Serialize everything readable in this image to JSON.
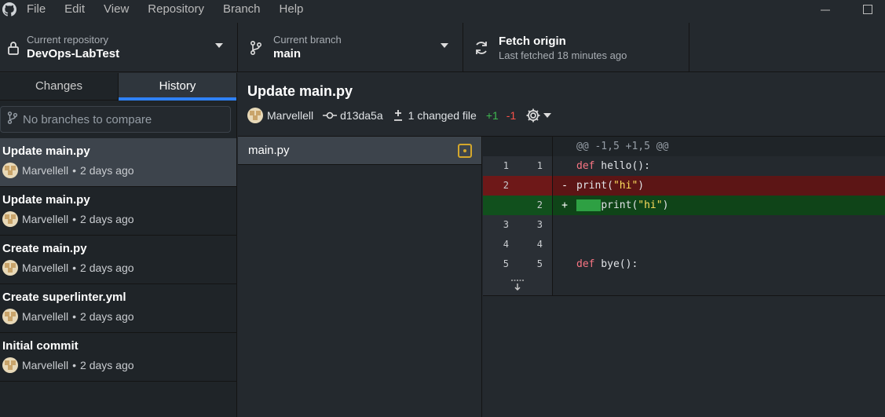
{
  "menu": [
    "File",
    "Edit",
    "View",
    "Repository",
    "Branch",
    "Help"
  ],
  "toolbar": {
    "repo_label": "Current repository",
    "repo_name": "DevOps-LabTest",
    "branch_label": "Current branch",
    "branch_name": "main",
    "fetch_title": "Fetch origin",
    "fetch_sub": "Last fetched 18 minutes ago"
  },
  "sidebar": {
    "tabs": [
      "Changes",
      "History"
    ],
    "active_tab": "History",
    "compare_placeholder": "No branches to compare",
    "commits": [
      {
        "title": "Update main.py",
        "author": "Marvellell",
        "when": "2 days ago",
        "selected": true
      },
      {
        "title": "Update main.py",
        "author": "Marvellell",
        "when": "2 days ago"
      },
      {
        "title": "Create main.py",
        "author": "Marvellell",
        "when": "2 days ago"
      },
      {
        "title": "Create superlinter.yml",
        "author": "Marvellell",
        "when": "2 days ago"
      },
      {
        "title": "Initial commit",
        "author": "Marvellell",
        "when": "2 days ago"
      }
    ]
  },
  "commit": {
    "title": "Update main.py",
    "author": "Marvellell",
    "sha": "d13da5a",
    "changed": "1 changed file",
    "additions": "+1",
    "deletions": "-1"
  },
  "files": [
    {
      "name": "main.py",
      "status": "modified"
    }
  ],
  "diff": {
    "hunk": "@@ -1,5 +1,5 @@",
    "lines": [
      {
        "type": "ctx",
        "old": "1",
        "new": "1",
        "sign": "",
        "kw": "def",
        "rest": " hello():"
      },
      {
        "type": "del",
        "old": "2",
        "new": "",
        "sign": "-",
        "pre": "print(",
        "str": "\"hi\"",
        "post": ")"
      },
      {
        "type": "add",
        "old": "",
        "new": "2",
        "sign": "+",
        "pre": "print(",
        "str": "\"hi\"",
        "post": ")"
      },
      {
        "type": "ctx",
        "old": "3",
        "new": "3",
        "sign": ""
      },
      {
        "type": "ctx",
        "old": "4",
        "new": "4",
        "sign": ""
      },
      {
        "type": "ctx",
        "old": "5",
        "new": "5",
        "sign": "",
        "kw": "def",
        "rest": " bye():"
      }
    ]
  },
  "colors": {
    "accent": "#2f81f7",
    "added": "#3fb950",
    "removed": "#f85149",
    "modified": "#d4a72c"
  }
}
